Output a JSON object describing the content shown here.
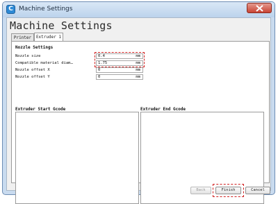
{
  "window": {
    "title": "Machine Settings",
    "app_icon_letter": "C"
  },
  "page_title": "Machine Settings",
  "tabs": [
    {
      "label": "Printer"
    },
    {
      "label": "Extruder 1"
    }
  ],
  "nozzle_section": {
    "title": "Nozzle Settings"
  },
  "fields": [
    {
      "label": "Nozzle size",
      "value": "0.4",
      "unit": "mm"
    },
    {
      "label": "Compatible material diam…",
      "value": "1.75",
      "unit": "mm"
    },
    {
      "label": "Nozzle offset X",
      "value": "0",
      "unit": "mm"
    },
    {
      "label": "Nozzle offset Y",
      "value": "0",
      "unit": "mm"
    }
  ],
  "start_gcode": {
    "title": "Extruder Start Gcode",
    "value": ""
  },
  "end_gcode": {
    "title": "Extruder End Gcode",
    "value": ""
  },
  "buttons": {
    "back": "Back",
    "finish": "Finish",
    "cancel": "Cancel"
  },
  "highlight_color": "#d02020"
}
